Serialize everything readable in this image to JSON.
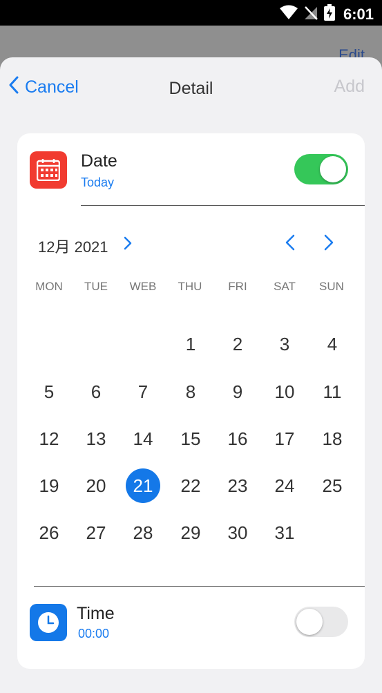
{
  "status_bar": {
    "time": "6:01",
    "icons": [
      "wifi-icon",
      "no-signal-icon",
      "battery-charging-icon"
    ]
  },
  "background": {
    "edit_label": "Edit"
  },
  "nav": {
    "cancel_label": "Cancel",
    "title": "Detail",
    "add_label": "Add"
  },
  "date_row": {
    "title": "Date",
    "subtitle": "Today",
    "toggle_on": true,
    "icon": "calendar-icon",
    "icon_color": "#f13b30"
  },
  "calendar": {
    "month_label": "12月 2021",
    "weekdays": [
      "MON",
      "TUE",
      "WEB",
      "THU",
      "FRI",
      "SAT",
      "SUN"
    ],
    "days": [
      "1",
      "2",
      "3",
      "4",
      "5",
      "6",
      "7",
      "8",
      "9",
      "10",
      "11",
      "12",
      "13",
      "14",
      "15",
      "16",
      "17",
      "18",
      "19",
      "20",
      "21",
      "22",
      "23",
      "24",
      "25",
      "26",
      "27",
      "28",
      "29",
      "30",
      "31"
    ],
    "first_weekday_index": 3,
    "selected_day": "21",
    "accent": "#1478e8"
  },
  "time_row": {
    "title": "Time",
    "subtitle": "00:00",
    "toggle_on": false,
    "icon": "clock-icon",
    "icon_color": "#1478e8"
  },
  "colors": {
    "accent": "#1a7cf0",
    "toggle_on": "#35c759",
    "toggle_off": "#e9e9ea",
    "disabled": "#c7c7cc"
  }
}
